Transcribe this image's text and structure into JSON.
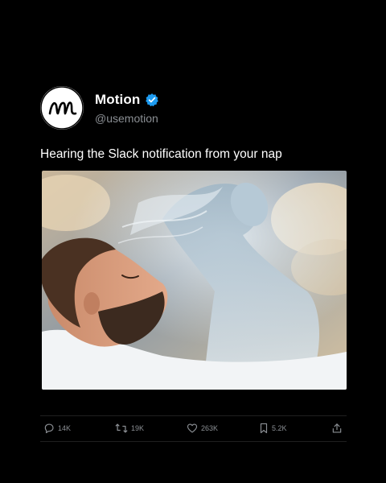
{
  "account": {
    "name": "Motion",
    "handle": "@usemotion",
    "verified": true,
    "avatar_icon": "motion-logo-icon"
  },
  "post": {
    "text": "Hearing the Slack notification from your nap",
    "media_icon": "ai-illustration-sleeping-man-soul-rising"
  },
  "actions": {
    "replies": "14K",
    "reposts": "19K",
    "likes": "263K",
    "bookmarks": "5.2K"
  },
  "colors": {
    "background": "#000000",
    "text": "#ffffff",
    "muted": "#8b8f94",
    "verified": "#1d9bf0"
  }
}
